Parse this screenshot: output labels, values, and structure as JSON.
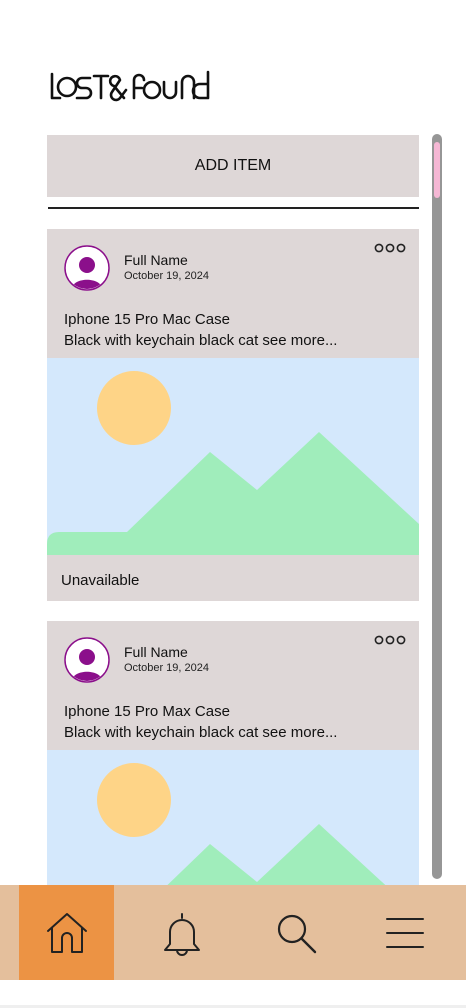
{
  "app": {
    "logo_text": "LOST&FOUND"
  },
  "actions": {
    "add_item_label": "ADD ITEM"
  },
  "posts": [
    {
      "author": "Full Name",
      "date": "October 19, 2024",
      "title": "Iphone 15 Pro Mac Case",
      "description": "Black with keychain black cat see more...",
      "status": "Unavailable"
    },
    {
      "author": "Full Name",
      "date": "October 19, 2024",
      "title": "Iphone 15 Pro Max Case",
      "description": "Black with keychain black cat see more..."
    }
  ],
  "nav": {
    "items": [
      {
        "icon": "home-icon",
        "active": true
      },
      {
        "icon": "bell-icon",
        "active": false
      },
      {
        "icon": "search-icon",
        "active": false
      },
      {
        "icon": "menu-icon",
        "active": false
      }
    ]
  },
  "colors": {
    "card_bg": "#ded7d7",
    "nav_bg": "#e4bf9c",
    "nav_active": "#ec9344",
    "avatar": "#8b0f8b",
    "photo_sky": "#d4e8fc",
    "photo_sun": "#fed487",
    "photo_hills": "#a0edbb",
    "scroll_track": "#969696",
    "scroll_thumb": "#f5b7d4"
  }
}
